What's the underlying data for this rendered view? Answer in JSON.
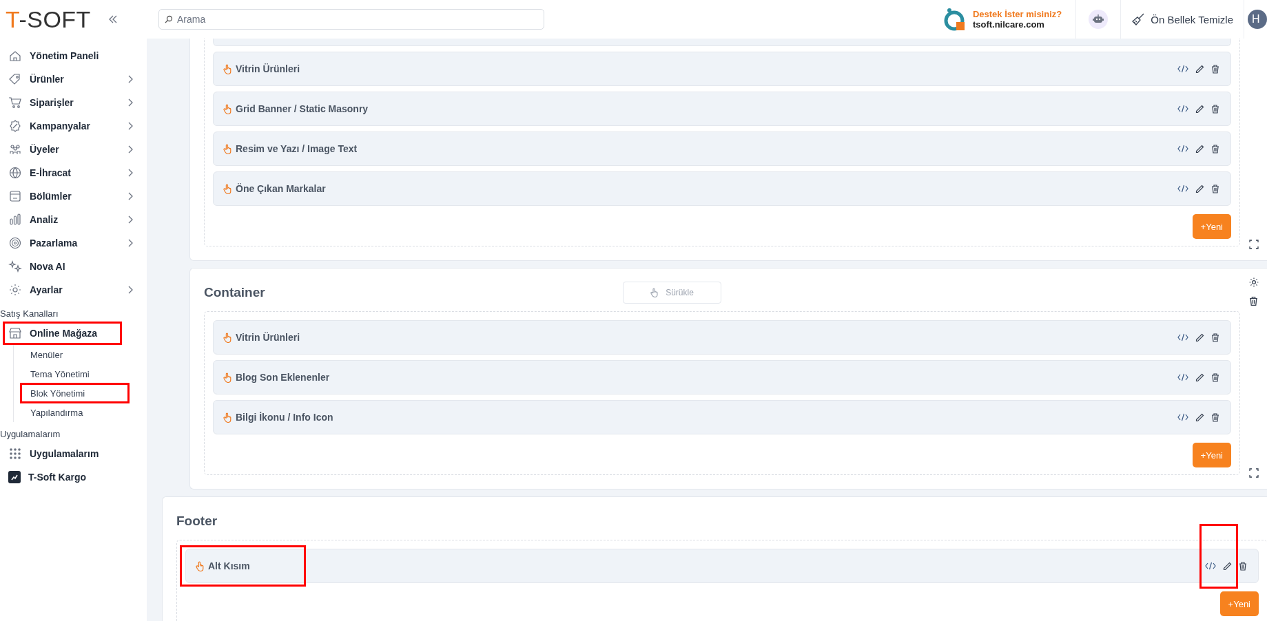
{
  "header": {
    "logo": {
      "accent": "T",
      "rest": "-SOFT"
    },
    "search": {
      "placeholder": "Arama"
    },
    "support": {
      "title": "Destek İster misiniz?",
      "domain": "tsoft.nilcare.com"
    },
    "clear_cache": "Ön Bellek Temizle",
    "avatar": "H"
  },
  "sidebar": {
    "items": [
      {
        "label": "Yönetim Paneli",
        "expandable": false
      },
      {
        "label": "Ürünler",
        "expandable": true
      },
      {
        "label": "Siparişler",
        "expandable": true
      },
      {
        "label": "Kampanyalar",
        "expandable": true
      },
      {
        "label": "Üyeler",
        "expandable": true
      },
      {
        "label": "E-İhracat",
        "expandable": true
      },
      {
        "label": "Bölümler",
        "expandable": true
      },
      {
        "label": "Analiz",
        "expandable": true
      },
      {
        "label": "Pazarlama",
        "expandable": true
      },
      {
        "label": "Nova AI",
        "expandable": false
      },
      {
        "label": "Ayarlar",
        "expandable": true
      }
    ],
    "groups": [
      {
        "title": "Satış Kanalları",
        "items": [
          {
            "label": "Online Mağaza",
            "highlighted": true,
            "children": [
              {
                "label": "Menüler",
                "highlighted": false
              },
              {
                "label": "Tema Yönetimi",
                "highlighted": false
              },
              {
                "label": "Blok Yönetimi",
                "highlighted": true
              },
              {
                "label": "Yapılandırma",
                "highlighted": false
              }
            ]
          }
        ]
      },
      {
        "title": "Uygulamalarım",
        "items": [
          {
            "label": "Uygulamalarım",
            "highlighted": false
          },
          {
            "label": "T-Soft Kargo",
            "highlighted": false
          }
        ]
      }
    ]
  },
  "sections": [
    {
      "kind": "clipped",
      "settings_visible": false,
      "rows": [
        {
          "kind": "clipped"
        },
        {
          "kind": "block",
          "label": "Vitrin Ürünleri",
          "label_highlighted": false,
          "actions_highlighted": false
        },
        {
          "kind": "block",
          "label": "Grid Banner / Static Masonry",
          "label_highlighted": false,
          "actions_highlighted": false
        },
        {
          "kind": "block",
          "label": "Resim ve Yazı / Image Text",
          "label_highlighted": false,
          "actions_highlighted": false
        },
        {
          "kind": "block",
          "label": "Öne Çıkan Markalar",
          "label_highlighted": false,
          "actions_highlighted": false
        }
      ],
      "add_button": "+Yeni"
    },
    {
      "kind": "nested",
      "title": "Container",
      "drag_button": "Sürükle",
      "settings_visible": true,
      "rows": [
        {
          "kind": "block",
          "label": "Vitrin Ürünleri",
          "label_highlighted": false,
          "actions_highlighted": false
        },
        {
          "kind": "block",
          "label": "Blog Son Eklenenler",
          "label_highlighted": false,
          "actions_highlighted": false
        },
        {
          "kind": "block",
          "label": "Bilgi İkonu / Info Icon",
          "label_highlighted": false,
          "actions_highlighted": false
        }
      ],
      "add_button": "+Yeni"
    },
    {
      "kind": "root",
      "title": "Footer",
      "rows": [
        {
          "kind": "block",
          "label": "Alt Kısım",
          "label_highlighted": true,
          "actions_highlighted": true
        }
      ],
      "add_button": "+Yeni"
    }
  ]
}
